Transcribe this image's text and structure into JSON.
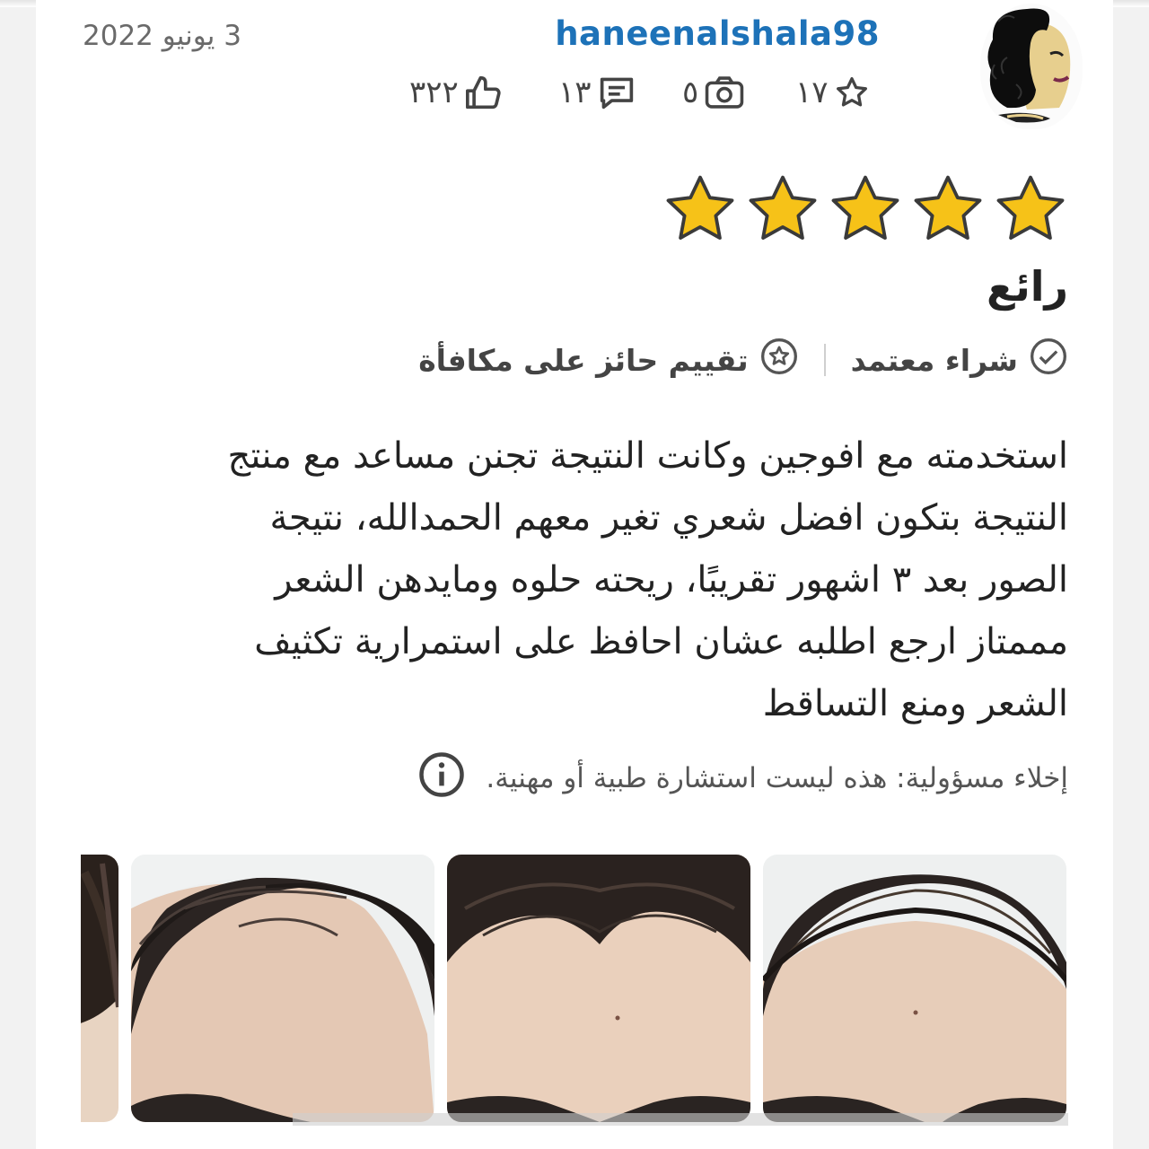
{
  "review": {
    "username": "haneenalshala98",
    "date": "3 يونيو 2022",
    "avatar": {
      "icon": "avatar-portrait-illustration"
    },
    "stats": {
      "reviews": "١٧",
      "photos": "٥",
      "comments": "١٣",
      "helpful": "٣٢٢"
    },
    "rating": {
      "value": 5,
      "max": 5,
      "star_color": "#f6c218"
    },
    "title": "رائع",
    "badges": {
      "verified": "شراء معتمد",
      "incentivized": "تقييم حائز على مكافأة"
    },
    "body_lines": [
      "استخدمته مع افوجين وكانت النتيجة تجنن مساعد مع منتج",
      "النتيجة بتكون افضل شعري تغير معهم الحمدالله، نتيجة",
      "الصور بعد ٣ اشهور تقريبًا، ريحته حلوه ومايدهن الشعر",
      "مممتاز ارجع اطلبه عشان احافظ على استمرارية تكثيف",
      "الشعر ومنع التساقط"
    ],
    "disclaimer": "إخلاء مسؤولية: هذه ليست استشارة طبية أو مهنية.",
    "photos": [
      {
        "icon": "hairline-photo-1"
      },
      {
        "icon": "hairline-photo-2"
      },
      {
        "icon": "hairline-photo-3"
      },
      {
        "icon": "hairline-photo-4"
      }
    ]
  },
  "colors": {
    "username": "#1d72b8",
    "text": "#222222",
    "muted": "#6a6a6a",
    "star_fill": "#f6c218",
    "star_stroke": "#3a3a3a"
  }
}
